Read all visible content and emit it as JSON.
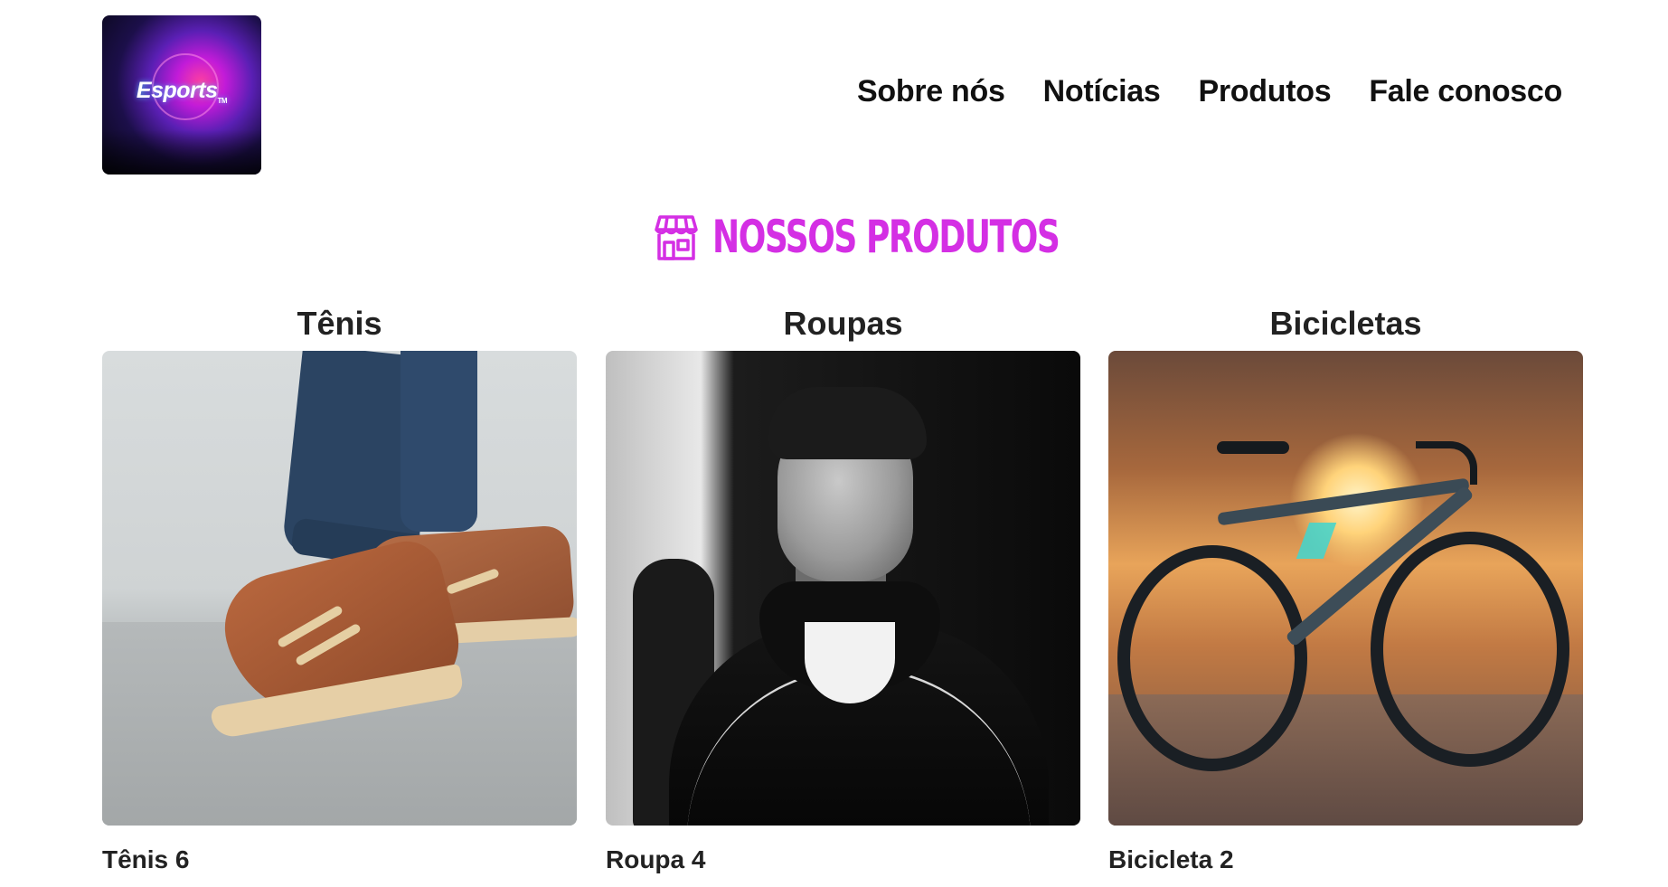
{
  "brand": {
    "logo_text": "Esports",
    "logo_tm": "TM"
  },
  "nav": {
    "items": [
      {
        "label": "Sobre nós"
      },
      {
        "label": "Notícias"
      },
      {
        "label": "Produtos"
      },
      {
        "label": "Fale conosco"
      }
    ]
  },
  "section": {
    "title": "NOSSOS PRODUTOS",
    "icon": "storefront-icon",
    "accent_color": "#d42fe4"
  },
  "products": [
    {
      "category": "Tênis",
      "image": "sneakers-photo",
      "caption": "Tênis 6"
    },
    {
      "category": "Roupas",
      "image": "man-jacket-photo",
      "caption": "Roupa 4"
    },
    {
      "category": "Bicicletas",
      "image": "road-bike-photo",
      "caption": "Bicicleta 2"
    }
  ]
}
